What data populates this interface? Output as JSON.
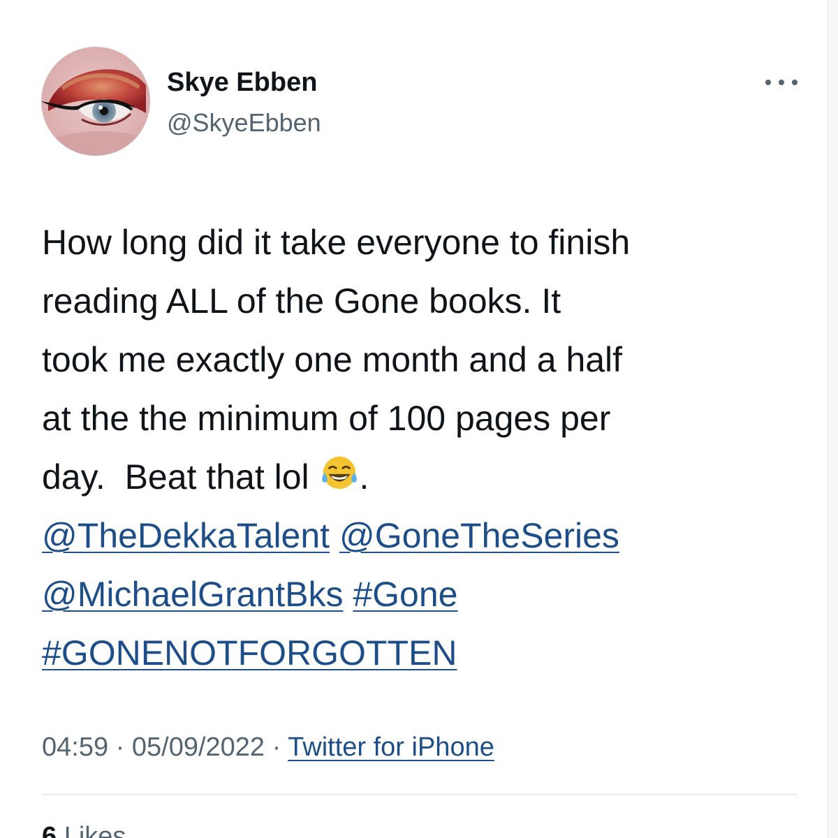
{
  "author": {
    "display_name": "Skye Ebben",
    "handle": "@SkyeEbben",
    "avatar_icon": "eye-makeup-avatar"
  },
  "menu_icon": "more-options-icon",
  "tweet": {
    "line1": "How long did it take everyone to finish",
    "line2": "reading ALL of the Gone books.  It",
    "line3": "took me exactly one month and a half",
    "line4": "at the the minimum of 100 pages per",
    "line5_text": "day.  Beat that lol ",
    "line5_emoji": "laughing-tears-emoji",
    "line5_after": ".",
    "mentions": [
      "@TheDekkaTalent",
      "@GoneTheSeries",
      "@MichaelGrantBks"
    ],
    "hashtags": [
      "#Gone",
      "#GONENOTFORGOTTEN"
    ]
  },
  "meta": {
    "time": "04:59",
    "separator": " · ",
    "date": "05/09/2022",
    "source": "Twitter for iPhone"
  },
  "stats": {
    "likes_count": "6",
    "likes_label": " Likes"
  },
  "colors": {
    "link": "#1d4e89",
    "secondary_text": "#536471",
    "primary_text": "#0f1419"
  }
}
